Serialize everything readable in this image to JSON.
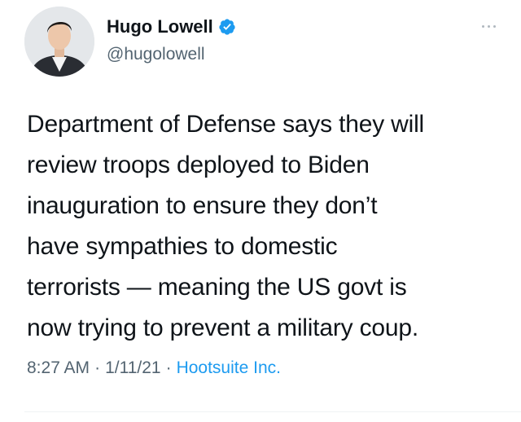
{
  "author": {
    "display_name": "Hugo Lowell",
    "handle": "@hugolowell",
    "verified": true,
    "avatar_icon": "profile-photo"
  },
  "tweet": {
    "lines": [
      "Department of Defense says they will",
      "review troops deployed to Biden",
      "inauguration to ensure they don’t",
      "have sympathies to domestic",
      "terrorists — meaning the US govt is",
      "now trying to prevent a military coup."
    ]
  },
  "meta": {
    "time": "8:27 AM",
    "separator": "·",
    "date": "1/11/21",
    "source": "Hootsuite Inc."
  },
  "colors": {
    "verified_blue": "#1d9bf0",
    "link_blue": "#1d9bf0",
    "secondary_text": "#536471"
  },
  "icons": {
    "verified": "verified-badge-icon",
    "more": "more-options-icon"
  }
}
